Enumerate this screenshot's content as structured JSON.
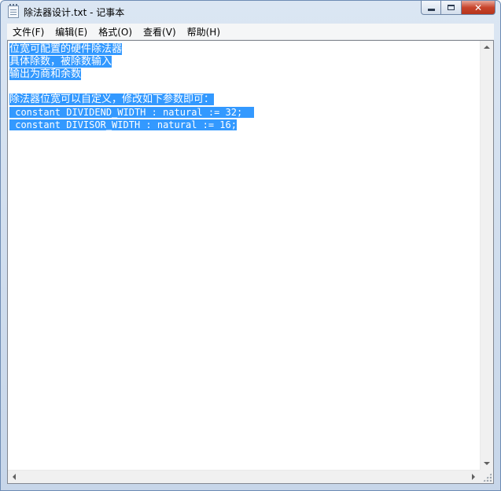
{
  "window": {
    "title": "除法器设计.txt - 记事本"
  },
  "menu": {
    "items": [
      {
        "label": "文件(F)"
      },
      {
        "label": "编辑(E)"
      },
      {
        "label": "格式(O)"
      },
      {
        "label": "查看(V)"
      },
      {
        "label": "帮助(H)"
      }
    ]
  },
  "document": {
    "lines": [
      "位宽可配置的硬件除法器",
      "具体除数，被除数输入",
      "输出为商和余数",
      "",
      "除法器位宽可以自定义，修改如下参数即可：",
      " constant DIVIDEND_WIDTH : natural := 32;",
      " constant DIVISOR_WIDTH : natural := 16;"
    ],
    "selection": "all"
  },
  "colors": {
    "selection_bg": "#3399ff",
    "selection_fg": "#ffffff",
    "close_button": "#c8452c"
  },
  "icons": {
    "app": "notepad-icon",
    "minimize": "minimize-icon",
    "maximize": "maximize-icon",
    "close": "close-icon"
  }
}
